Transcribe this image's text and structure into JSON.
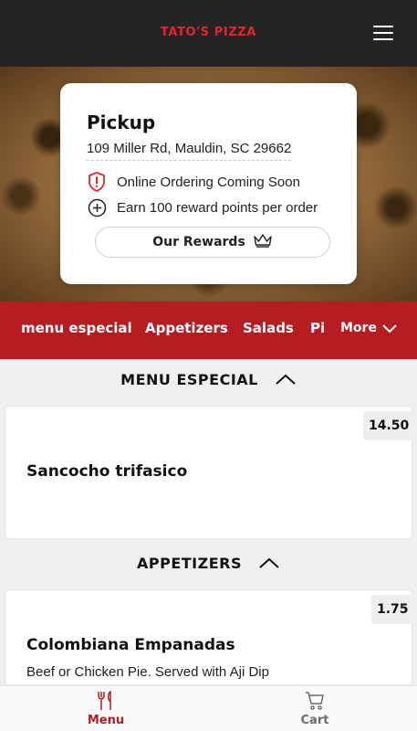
{
  "header": {
    "brand": "TATO'S PIZZA",
    "menu_icon": "hamburger-icon"
  },
  "pickup_card": {
    "title": "Pickup",
    "address": "109 Miller Rd, Mauldin, SC 29662",
    "notices": [
      {
        "icon": "shield-alert-icon",
        "text": "Online Ordering Coming Soon"
      },
      {
        "icon": "plus-circle-icon",
        "text": "Earn 100 reward points per order"
      }
    ],
    "rewards_button": {
      "label": "Our Rewards",
      "icon": "crown-icon"
    }
  },
  "categories": {
    "items": [
      "menu especial",
      "Appetizers",
      "Salads",
      "Pi"
    ],
    "more_label": "More"
  },
  "sections": [
    {
      "title": "MENU ESPECIAL",
      "items": [
        {
          "name": "Sancocho trifasico",
          "price": "14.50",
          "description": ""
        }
      ]
    },
    {
      "title": "APPETIZERS",
      "items": [
        {
          "name": "Colombiana Empanadas",
          "price": "1.75",
          "description": "Beef or Chicken Pie. Served with Aji Dip"
        }
      ]
    }
  ],
  "bottom_nav": [
    {
      "label": "Menu",
      "icon": "fork-knife-icon",
      "active": true
    },
    {
      "label": "Cart",
      "icon": "cart-icon",
      "active": false
    }
  ],
  "colors": {
    "brand_red": "#e3262a",
    "category_bar": "#b71c22",
    "active_nav": "#b71c22",
    "inactive_nav": "#6b6b6b",
    "header_bg": "#242424"
  }
}
